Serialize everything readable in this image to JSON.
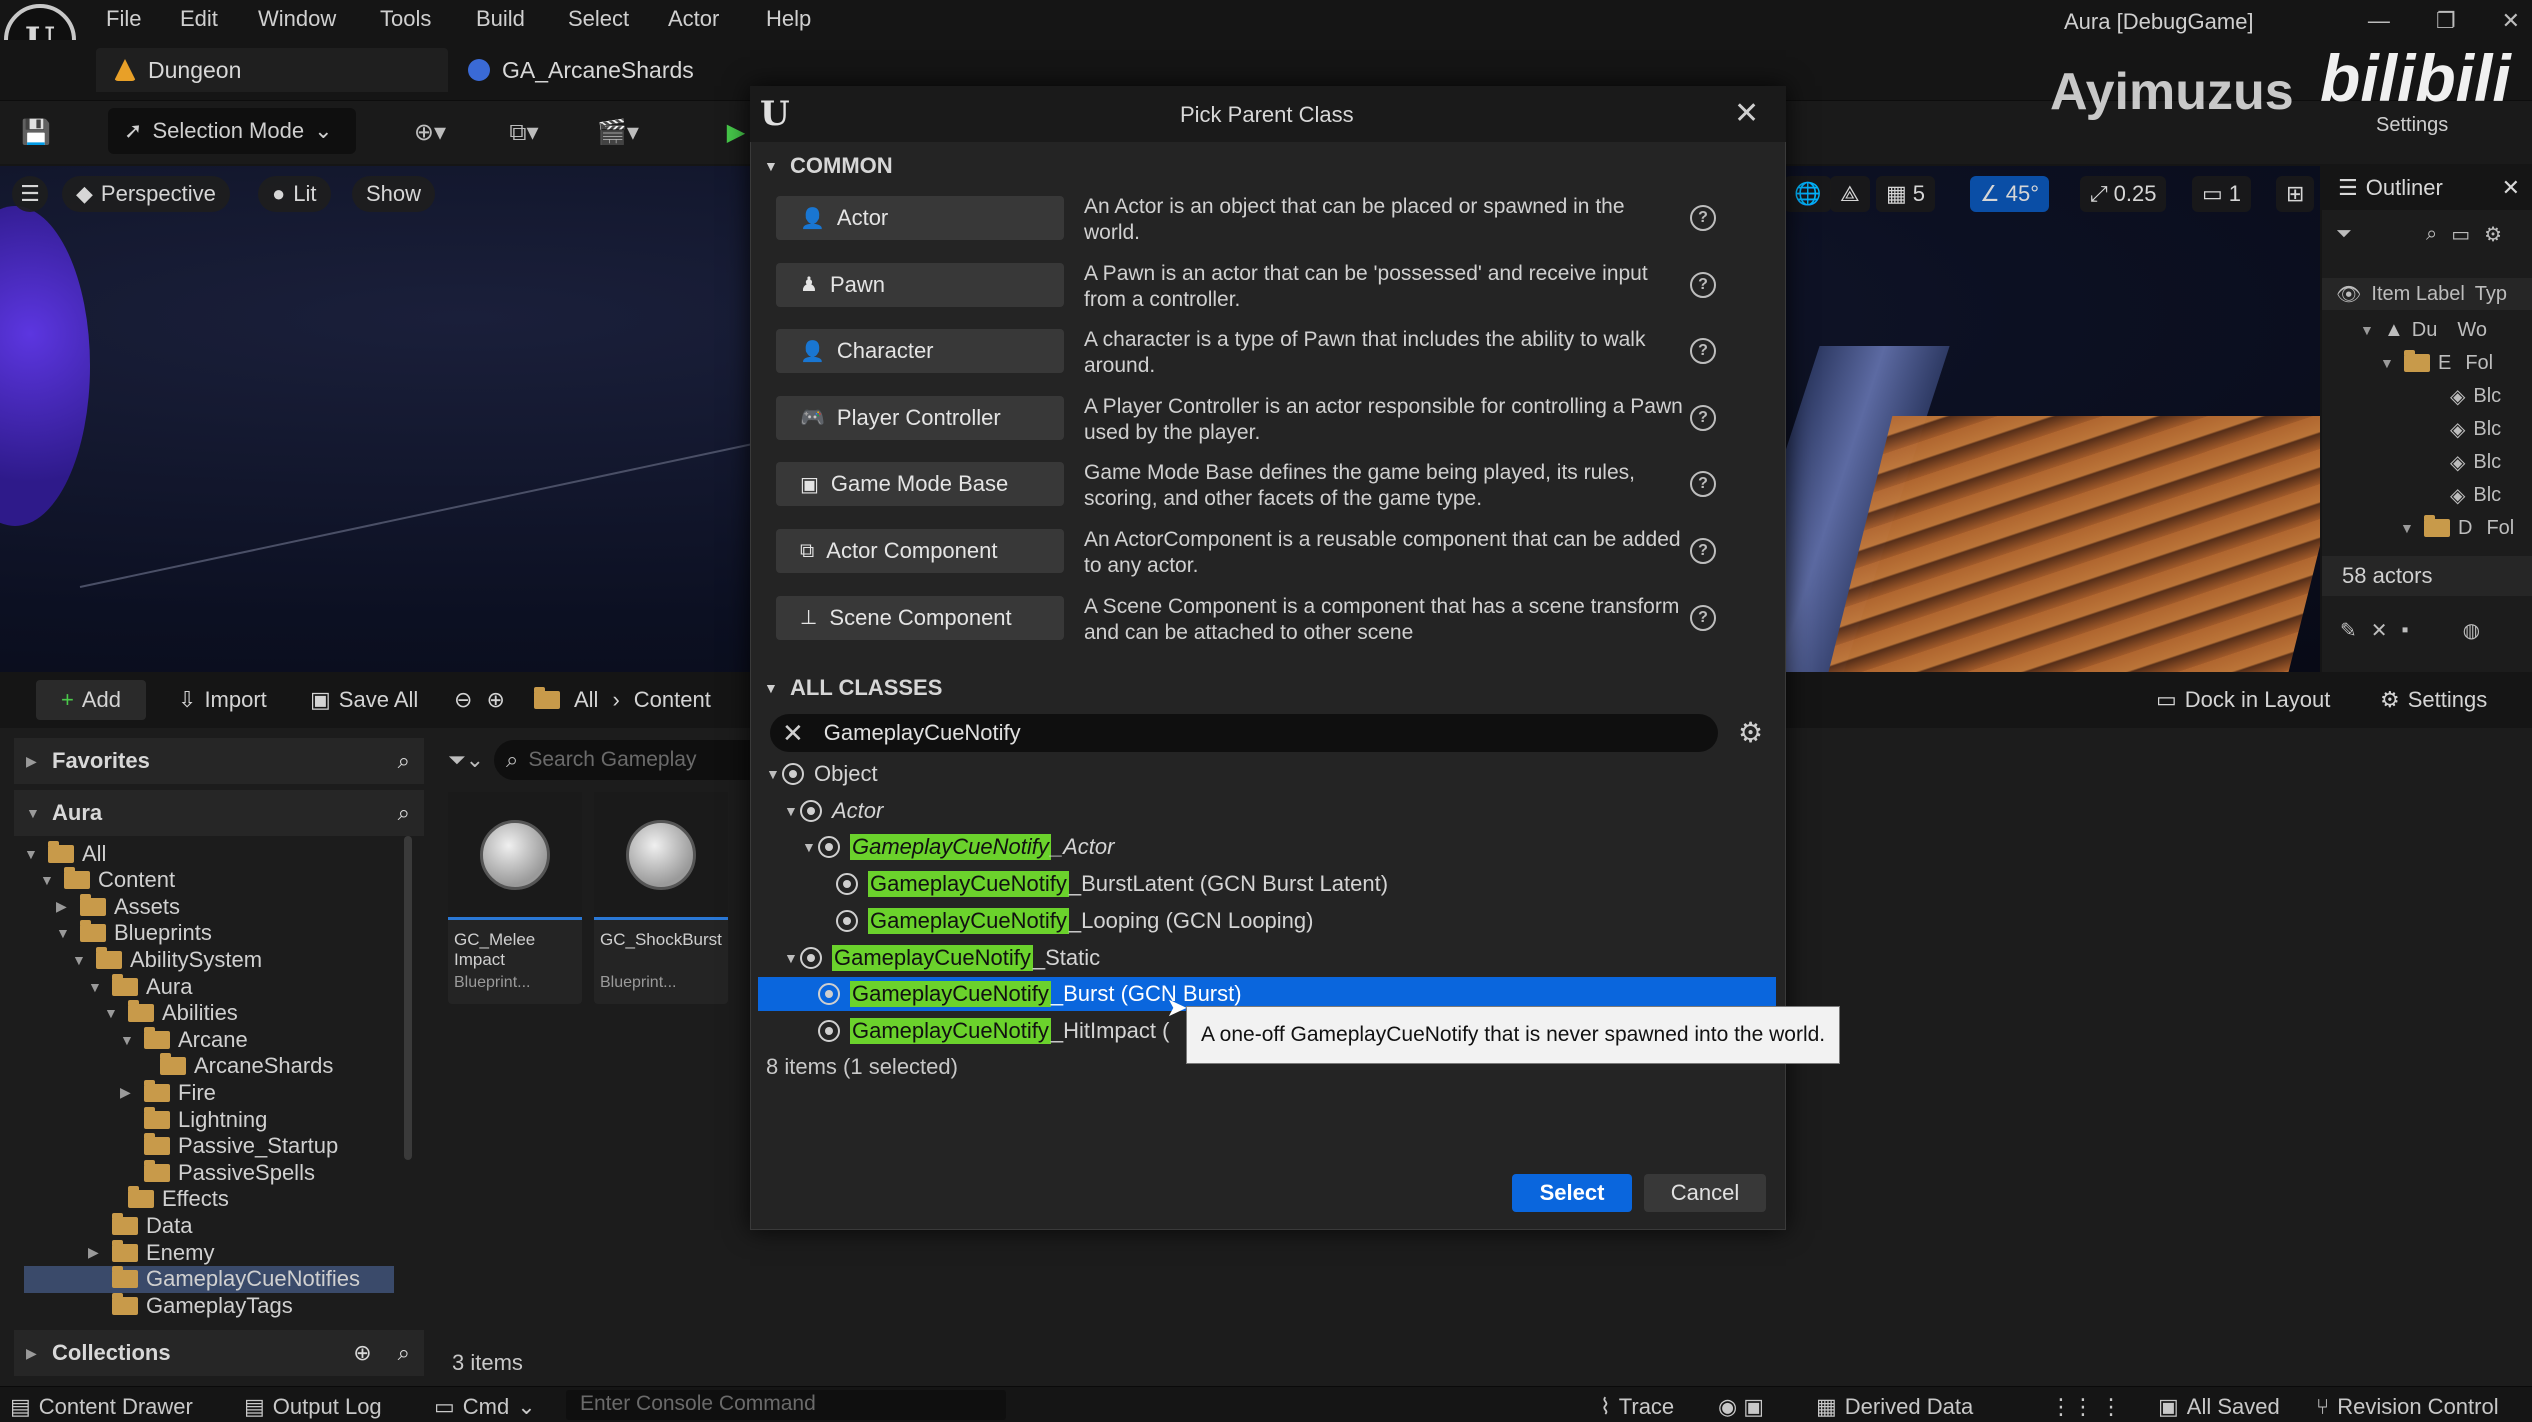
{
  "menubar": {
    "items": [
      "File",
      "Edit",
      "Window",
      "Tools",
      "Build",
      "Select",
      "Actor",
      "Help"
    ],
    "window_title": "Aura [DebugGame]"
  },
  "tabs": [
    {
      "label": "Dungeon"
    },
    {
      "label": "GA_ArcaneShards"
    }
  ],
  "toolbar": {
    "selection_mode": "Selection Mode"
  },
  "viewport": {
    "perspective": "Perspective",
    "lit": "Lit",
    "show": "Show",
    "grid_snap": "5",
    "angle_snap": "45°",
    "scale_snap": "0.25",
    "camera_speed": "1"
  },
  "outliner": {
    "title": "Outliner",
    "col_label": "Item Label",
    "col_type": "Typ",
    "rows": [
      {
        "label": "Du",
        "type": "Wo"
      },
      {
        "label": "E",
        "type": "Fol"
      },
      {
        "label": "",
        "type": "Blc"
      },
      {
        "label": "",
        "type": "Blc"
      },
      {
        "label": "",
        "type": "Blc"
      },
      {
        "label": "",
        "type": "Blc"
      },
      {
        "label": "D",
        "type": "Fol"
      }
    ],
    "actor_count": "58 actors"
  },
  "content_browser": {
    "add": "Add",
    "import": "Import",
    "save_all": "Save All",
    "path": [
      "All",
      "Content"
    ],
    "search_placeholder": "Search Gameplay",
    "dock_in_layout": "Dock in Layout",
    "settings": "Settings",
    "favorites": "Favorites",
    "root": "Aura",
    "collections": "Collections",
    "tree": [
      {
        "label": "All",
        "indent": 0,
        "expanded": true
      },
      {
        "label": "Content",
        "indent": 1,
        "expanded": true
      },
      {
        "label": "Assets",
        "indent": 2,
        "expanded": false
      },
      {
        "label": "Blueprints",
        "indent": 2,
        "expanded": true
      },
      {
        "label": "AbilitySystem",
        "indent": 3,
        "expanded": true
      },
      {
        "label": "Aura",
        "indent": 4,
        "expanded": true
      },
      {
        "label": "Abilities",
        "indent": 5,
        "expanded": true
      },
      {
        "label": "Arcane",
        "indent": 6,
        "expanded": true
      },
      {
        "label": "ArcaneShards",
        "indent": 7,
        "expanded": null
      },
      {
        "label": "Fire",
        "indent": 6,
        "expanded": false
      },
      {
        "label": "Lightning",
        "indent": 6,
        "expanded": null
      },
      {
        "label": "Passive_Startup",
        "indent": 6,
        "expanded": null
      },
      {
        "label": "PassiveSpells",
        "indent": 6,
        "expanded": null
      },
      {
        "label": "Effects",
        "indent": 5,
        "expanded": null
      },
      {
        "label": "Data",
        "indent": 4,
        "expanded": null
      },
      {
        "label": "Enemy",
        "indent": 4,
        "expanded": false
      },
      {
        "label": "GameplayCueNotifies",
        "indent": 4,
        "expanded": null,
        "selected": true
      },
      {
        "label": "GameplayTags",
        "indent": 4,
        "expanded": null
      }
    ],
    "assets": [
      {
        "name": "GC_Melee Impact",
        "type": "Blueprint..."
      },
      {
        "name": "GC_ShockBurst",
        "type": "Blueprint..."
      }
    ],
    "item_count": "3 items"
  },
  "statusbar": {
    "content_drawer": "Content Drawer",
    "output_log": "Output Log",
    "cmd": "Cmd",
    "console_placeholder": "Enter Console Command",
    "trace": "Trace",
    "derived_data": "Derived Data",
    "all_saved": "All Saved",
    "revision_control": "Revision Control"
  },
  "dialog": {
    "title": "Pick Parent Class",
    "common_header": "COMMON",
    "common": [
      {
        "label": "Actor",
        "icon": "actor-icon",
        "desc": "An Actor is an object that can be placed or spawned in the world."
      },
      {
        "label": "Pawn",
        "icon": "pawn-icon",
        "desc": "A Pawn is an actor that can be 'possessed' and receive input from a controller."
      },
      {
        "label": "Character",
        "icon": "character-icon",
        "desc": "A character is a type of Pawn that includes the ability to walk around."
      },
      {
        "label": "Player Controller",
        "icon": "gamepad-icon",
        "desc": "A Player Controller is an actor responsible for controlling a Pawn used by the player."
      },
      {
        "label": "Game Mode Base",
        "icon": "gamemode-icon",
        "desc": "Game Mode Base defines the game being played, its rules, scoring, and other facets of the game type."
      },
      {
        "label": "Actor Component",
        "icon": "component-icon",
        "desc": "An ActorComponent is a reusable component that can be added to any actor."
      },
      {
        "label": "Scene Component",
        "icon": "scene-component-icon",
        "desc": "A Scene Component is a component that has a scene transform and can be attached to other scene"
      }
    ],
    "all_classes_header": "ALL CLASSES",
    "search_value": "GameplayCueNotify",
    "classes": [
      {
        "indent": 0,
        "arrow": "▼",
        "match": "",
        "rest": "Object",
        "italic": false
      },
      {
        "indent": 1,
        "arrow": "▼",
        "match": "",
        "rest": "Actor",
        "italic": true
      },
      {
        "indent": 2,
        "arrow": "▼",
        "match": "GameplayCueNotify",
        "rest": "_Actor",
        "italic": true
      },
      {
        "indent": 3,
        "arrow": "",
        "match": "GameplayCueNotify",
        "rest": "_BurstLatent (GCN Burst Latent)",
        "italic": false
      },
      {
        "indent": 3,
        "arrow": "",
        "match": "GameplayCueNotify",
        "rest": "_Looping (GCN Looping)",
        "italic": false
      },
      {
        "indent": 1,
        "arrow": "▼",
        "match": "GameplayCueNotify",
        "rest": "_Static",
        "italic": false
      },
      {
        "indent": 2,
        "arrow": "",
        "match": "GameplayCueNotify",
        "rest": "_Burst (GCN Burst)",
        "italic": false,
        "selected": true
      },
      {
        "indent": 2,
        "arrow": "",
        "match": "GameplayCueNotify",
        "rest": "_HitImpact (",
        "italic": false
      }
    ],
    "item_count": "8 items (1 selected)",
    "tooltip": "A one-off GameplayCueNotify that is never spawned into the world.",
    "select_label": "Select",
    "cancel_label": "Cancel"
  },
  "watermark": {
    "name": "Ayimuzus",
    "site": "bilibili",
    "site_settings": "Settings"
  }
}
